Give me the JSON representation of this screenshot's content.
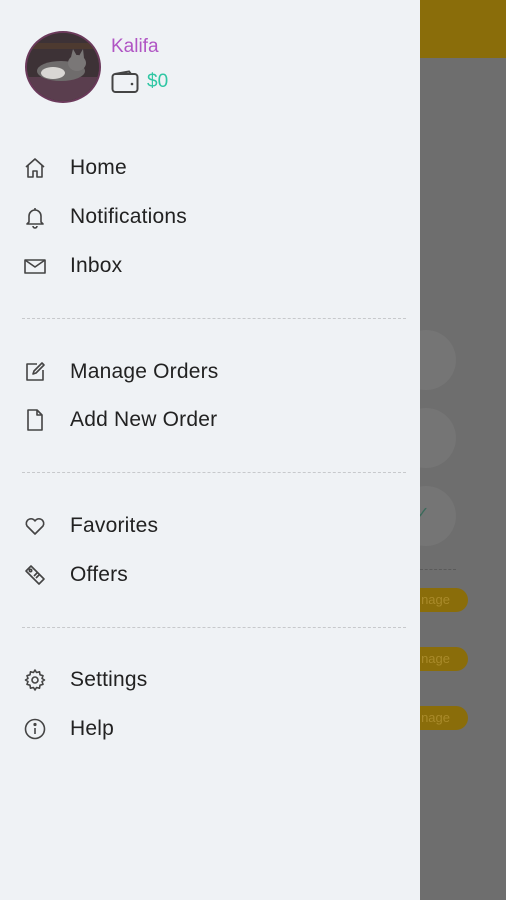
{
  "profile": {
    "name": "Kalifa",
    "balance": "$0"
  },
  "menu": {
    "home": "Home",
    "notifications": "Notifications",
    "inbox": "Inbox",
    "manage_orders": "Manage Orders",
    "add_new_order": "Add New Order",
    "favorites": "Favorites",
    "offers": "Offers",
    "settings": "Settings",
    "help": "Help"
  },
  "background": {
    "pill_label": "nage"
  },
  "colors": {
    "name": "#b055c4",
    "balance": "#2fc6a3",
    "drawer_bg": "#eff2f5",
    "accent_bar": "#8a6d0a"
  }
}
